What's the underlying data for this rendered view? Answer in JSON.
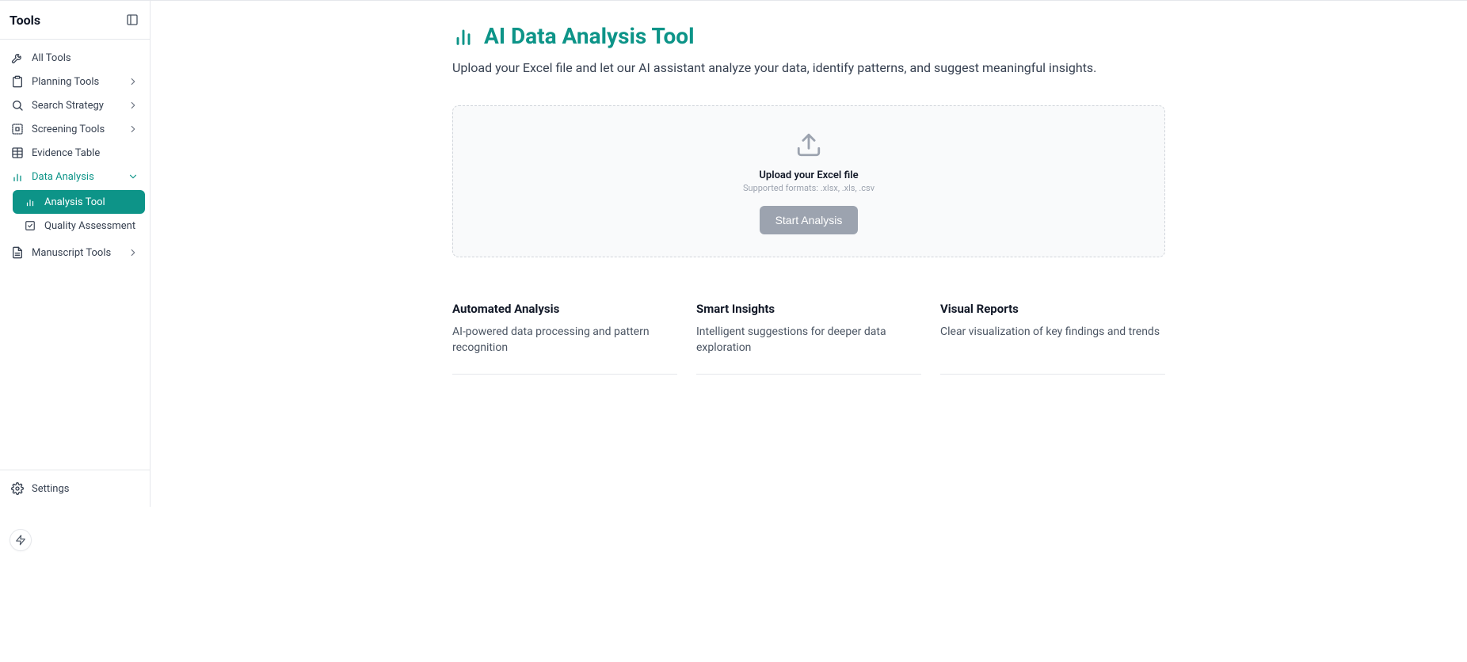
{
  "sidebar": {
    "title": "Tools",
    "items": [
      {
        "label": "All Tools",
        "icon": "wrench",
        "expandable": false
      },
      {
        "label": "Planning Tools",
        "icon": "clipboard",
        "expandable": true
      },
      {
        "label": "Search Strategy",
        "icon": "search",
        "expandable": true
      },
      {
        "label": "Screening Tools",
        "icon": "grid-dots",
        "expandable": true
      },
      {
        "label": "Evidence Table",
        "icon": "table",
        "expandable": false
      },
      {
        "label": "Data Analysis",
        "icon": "bar-chart",
        "expandable": true,
        "expanded": true,
        "children": [
          {
            "label": "Analysis Tool",
            "icon": "bar-chart",
            "active": true
          },
          {
            "label": "Quality Assessment",
            "icon": "check-square",
            "active": false
          }
        ]
      },
      {
        "label": "Manuscript Tools",
        "icon": "file-text",
        "expandable": true
      }
    ],
    "footer": {
      "label": "Settings",
      "icon": "settings"
    }
  },
  "main": {
    "title": "AI Data Analysis Tool",
    "subtitle": "Upload your Excel file and let our AI assistant analyze your data, identify patterns, and suggest meaningful insights.",
    "upload": {
      "heading": "Upload your Excel file",
      "formats": "Supported formats: .xlsx, .xls, .csv",
      "button": "Start Analysis"
    },
    "features": [
      {
        "title": "Automated Analysis",
        "desc": "AI-powered data processing and pattern recognition"
      },
      {
        "title": "Smart Insights",
        "desc": "Intelligent suggestions for deeper data exploration"
      },
      {
        "title": "Visual Reports",
        "desc": "Clear visualization of key findings and trends"
      }
    ]
  }
}
